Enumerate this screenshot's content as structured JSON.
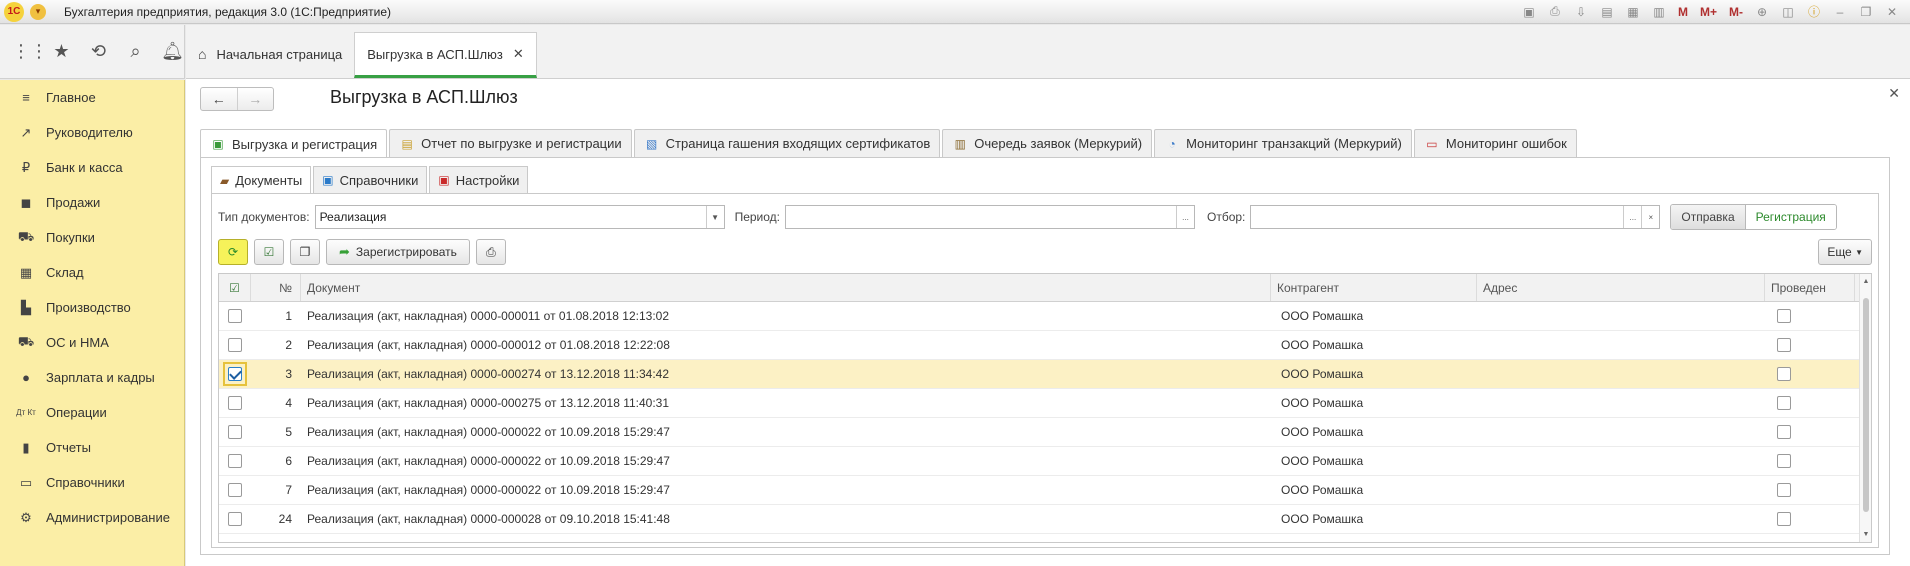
{
  "window": {
    "title": "Бухгалтерия предприятия, редакция 3.0  (1С:Предприятие)",
    "tools_m": [
      "M",
      "M+",
      "M-"
    ]
  },
  "sidebar": {
    "items": [
      {
        "label": "Главное",
        "icon": "menu-icon"
      },
      {
        "label": "Руководителю",
        "icon": "trend-icon"
      },
      {
        "label": "Банк и касса",
        "icon": "ruble-icon"
      },
      {
        "label": "Продажи",
        "icon": "bag-icon"
      },
      {
        "label": "Покупки",
        "icon": "cart-icon"
      },
      {
        "label": "Склад",
        "icon": "grid-icon"
      },
      {
        "label": "Производство",
        "icon": "factory-icon"
      },
      {
        "label": "ОС и НМА",
        "icon": "truck-icon"
      },
      {
        "label": "Зарплата и кадры",
        "icon": "person-icon"
      },
      {
        "label": "Операции",
        "icon": "dt-kt-icon"
      },
      {
        "label": "Отчеты",
        "icon": "bar-chart-icon"
      },
      {
        "label": "Справочники",
        "icon": "book-icon"
      },
      {
        "label": "Администрирование",
        "icon": "gear-icon"
      }
    ]
  },
  "tabs": {
    "home": "Начальная страница",
    "current": "Выгрузка в АСП.Шлюз"
  },
  "page": {
    "title": "Выгрузка в АСП.Шлюз"
  },
  "main_tabs": [
    "Выгрузка и регистрация",
    "Отчет по выгрузке и регистрации",
    "Страница гашения входящих сертификатов",
    "Очередь заявок (Меркурий)",
    "Мониторинг транзакций (Меркурий)",
    "Мониторинг ошибок"
  ],
  "sub_tabs": [
    "Документы",
    "Справочники",
    "Настройки"
  ],
  "filters": {
    "doc_type_label": "Тип документов:",
    "doc_type_value": "Реализация",
    "period_label": "Период:",
    "period_value": "",
    "filter_label": "Отбор:",
    "filter_value": "",
    "ellipsis": "...",
    "clear": "×",
    "seg_send": "Отправка",
    "seg_reg": "Регистрация"
  },
  "commands": {
    "register": "Зарегистрировать",
    "more": "Еще"
  },
  "table": {
    "headers": [
      "№",
      "Документ",
      "Контрагент",
      "Адрес",
      "Проведен"
    ],
    "rows": [
      {
        "n": "1",
        "doc": "Реализация (акт, накладная) 0000-000011 от 01.08.2018 12:13:02",
        "agent": "ООО Ромашка",
        "addr": "",
        "checked": false
      },
      {
        "n": "2",
        "doc": "Реализация (акт, накладная) 0000-000012 от 01.08.2018 12:22:08",
        "agent": "ООО Ромашка",
        "addr": "",
        "checked": false
      },
      {
        "n": "3",
        "doc": "Реализация (акт, накладная) 0000-000274 от 13.12.2018 11:34:42",
        "agent": "ООО Ромашка",
        "addr": "",
        "checked": true
      },
      {
        "n": "4",
        "doc": "Реализация (акт, накладная) 0000-000275 от 13.12.2018 11:40:31",
        "agent": "ООО Ромашка",
        "addr": "",
        "checked": false
      },
      {
        "n": "5",
        "doc": "Реализация (акт, накладная) 0000-000022 от 10.09.2018 15:29:47",
        "agent": "ООО Ромашка",
        "addr": "",
        "checked": false
      },
      {
        "n": "6",
        "doc": "Реализация (акт, накладная) 0000-000022 от 10.09.2018 15:29:47",
        "agent": "ООО Ромашка",
        "addr": "",
        "checked": false
      },
      {
        "n": "7",
        "doc": "Реализация (акт, накладная) 0000-000022 от 10.09.2018 15:29:47",
        "agent": "ООО Ромашка",
        "addr": "",
        "checked": false
      },
      {
        "n": "24",
        "doc": "Реализация (акт, накладная) 0000-000028 от 09.10.2018 15:41:48",
        "agent": "ООО Ромашка",
        "addr": "",
        "checked": false
      }
    ]
  },
  "colors": {
    "sidebar_bg": "#fbeea6",
    "accent_green": "#37a044",
    "selected_row": "#fcf1c5"
  }
}
